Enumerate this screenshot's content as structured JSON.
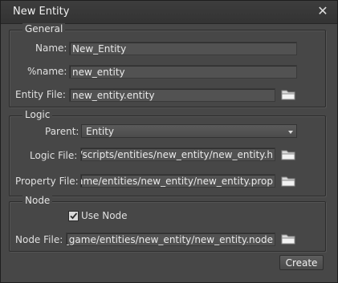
{
  "window": {
    "title": "New Entity",
    "close_glyph": "✕"
  },
  "general": {
    "label": "General",
    "name_label": "Name:",
    "name_value": "New_Entity",
    "pname_label": "%name:",
    "pname_value": "new_entity",
    "entity_file_label": "Entity File:",
    "entity_file_value": "new_entity.entity"
  },
  "logic": {
    "label": "Logic",
    "parent_label": "Parent:",
    "parent_value": "Entity",
    "logic_file_label": "Logic File:",
    "logic_file_value": "game/scripts/entities/new_entity/new_entity.h",
    "property_file_label": "Property File:",
    "property_file_value": "new_game/entities/new_entity/new_entity.prop"
  },
  "node": {
    "label": "Node",
    "use_node_label": "Use Node",
    "use_node_checked": true,
    "node_file_label": "Node File:",
    "node_file_value": "new_game/entities/new_entity/new_entity.node"
  },
  "actions": {
    "create_label": "Create"
  },
  "icons": {
    "folder": "folder-icon",
    "close": "close-icon",
    "dropdown": "chevron-down-icon",
    "check": "checkmark-icon"
  },
  "colors": {
    "background": "#474747",
    "field": "#525252",
    "text": "#e0e0e0"
  }
}
